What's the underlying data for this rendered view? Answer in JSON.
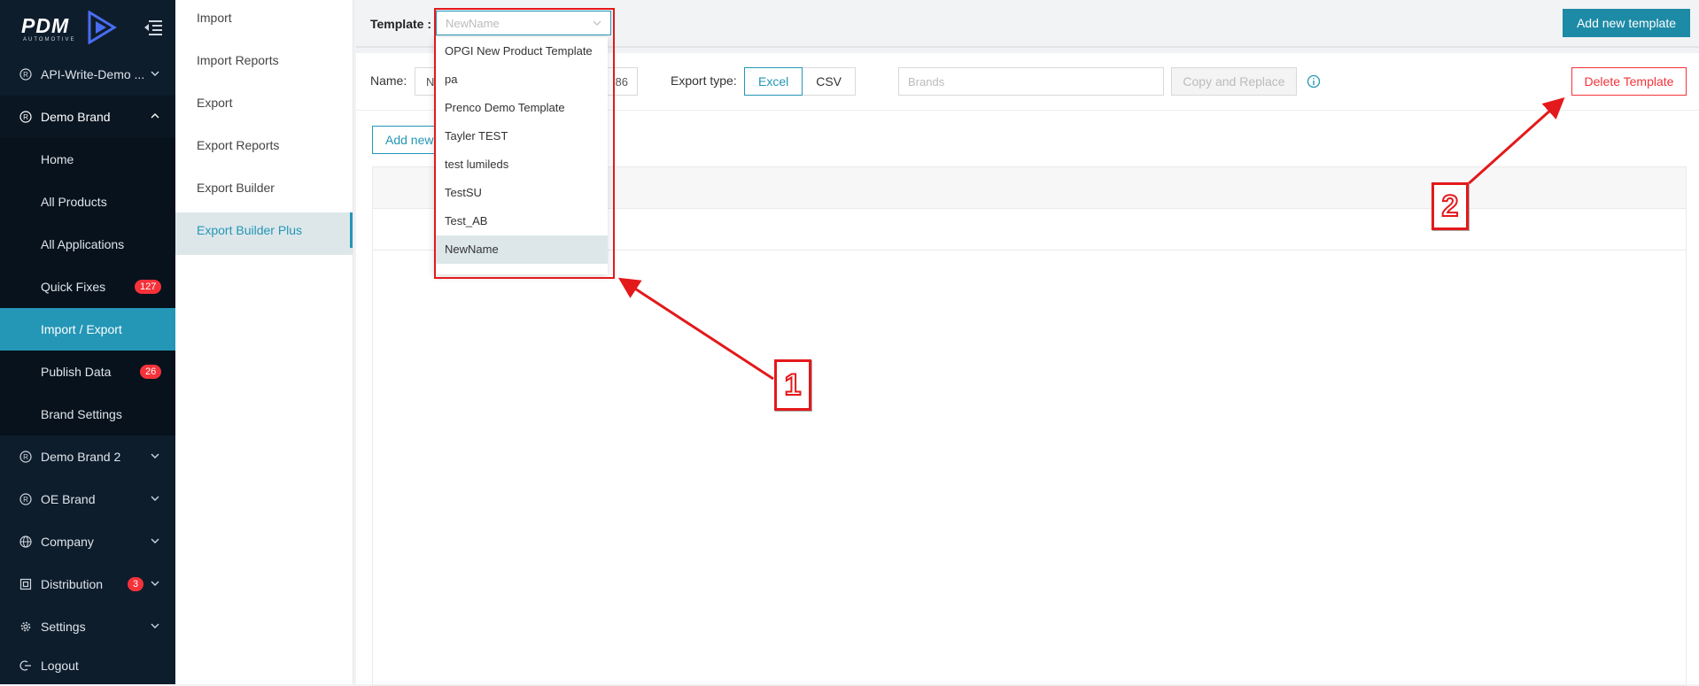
{
  "brand": {
    "logo_text": "PDM",
    "logo_sub": "AUTOMOTIVE"
  },
  "sidebar": {
    "items": [
      {
        "label": "API-Write-Demo ...",
        "icon": "registered-icon",
        "type": "top"
      },
      {
        "label": "Demo Brand",
        "icon": "registered-icon",
        "type": "top",
        "open": true
      },
      {
        "label": "Home",
        "type": "sub"
      },
      {
        "label": "All Products",
        "type": "sub"
      },
      {
        "label": "All Applications",
        "type": "sub"
      },
      {
        "label": "Quick Fixes",
        "type": "sub",
        "badge": "127"
      },
      {
        "label": "Import / Export",
        "type": "sub",
        "active": true
      },
      {
        "label": "Publish Data",
        "type": "sub",
        "badge": "26"
      },
      {
        "label": "Brand Settings",
        "type": "sub"
      },
      {
        "label": "Demo Brand 2",
        "icon": "registered-icon",
        "type": "top"
      },
      {
        "label": "OE Brand",
        "icon": "registered-icon",
        "type": "top"
      },
      {
        "label": "Company",
        "icon": "globe-icon",
        "type": "top"
      },
      {
        "label": "Distribution",
        "icon": "distribution-icon",
        "type": "top",
        "badge": "3"
      },
      {
        "label": "Settings",
        "icon": "gear-icon",
        "type": "top"
      },
      {
        "label": "Logout",
        "icon": "logout-icon",
        "type": "top"
      }
    ]
  },
  "subnav": {
    "items": [
      "Import",
      "Import Reports",
      "Export",
      "Export Reports",
      "Export Builder",
      "Export Builder Plus"
    ],
    "active_index": 5
  },
  "toolbar": {
    "template_label": "Template :",
    "template_value": "NewName",
    "add_template_label": "Add new template"
  },
  "form": {
    "name_label": "Name:",
    "name_value_start": "N",
    "name_value_end": "86",
    "export_type_label": "Export type:",
    "export_types": [
      "Excel",
      "CSV"
    ],
    "export_type_selected": "Excel",
    "brands_placeholder": "Brands",
    "copy_replace_label": "Copy and Replace",
    "delete_label": "Delete Template",
    "add_new_label": "Add new"
  },
  "dropdown": {
    "options": [
      "OPGI New Product Template",
      "pa",
      "Prenco Demo Template",
      "Tayler TEST",
      "test lumileds",
      "TestSU",
      "Test_AB",
      "NewName"
    ],
    "selected": "NewName"
  },
  "annotations": {
    "callout_1": "1",
    "callout_2": "2",
    "color": "#e3191b"
  },
  "colors": {
    "sidebar_bg": "#0e1d2c",
    "accent": "#2496b6",
    "danger": "#f5323a"
  }
}
